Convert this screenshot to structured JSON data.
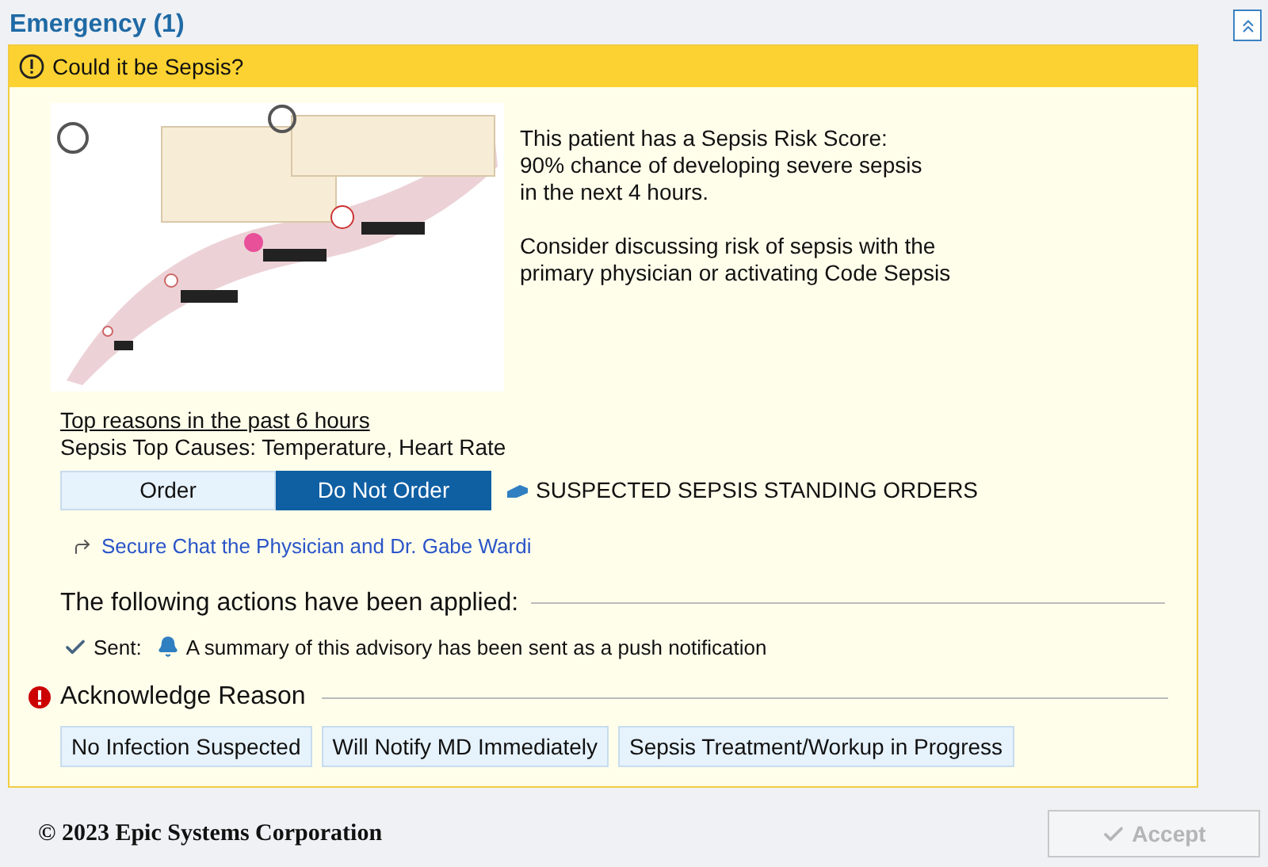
{
  "section": {
    "title": "Emergency (1)"
  },
  "advisory": {
    "title": "Could it be Sepsis?",
    "message": [
      "This patient has a Sepsis Risk Score:",
      "90% chance of developing severe sepsis",
      "in the next 4 hours."
    ],
    "consider": [
      "Consider discussing risk of sepsis with the",
      "primary physician or activating Code Sepsis"
    ],
    "reasons_heading": "Top reasons in the past 6 hours",
    "top_causes": "Sepsis Top Causes: Temperature, Heart Rate",
    "order_options": [
      {
        "label": "Order",
        "selected": false
      },
      {
        "label": "Do Not Order",
        "selected": true
      }
    ],
    "order_set": "SUSPECTED SEPSIS STANDING ORDERS",
    "chat_link": "Secure Chat the Physician and Dr. Gabe Wardi",
    "actions_heading": "The following actions have been applied:",
    "action": {
      "label": "Sent:",
      "text": "A summary of this advisory has been sent as a push notification"
    },
    "acknowledge": {
      "heading": "Acknowledge Reason",
      "required": true,
      "reasons": [
        {
          "label": "No Infection Suspected",
          "selected": false
        },
        {
          "label": "Will Notify MD Immediately",
          "selected": false
        },
        {
          "label": "Sepsis Treatment/Workup in Progress",
          "selected": false
        }
      ]
    }
  },
  "footer": {
    "copyright": "© 2023 Epic Systems Corporation",
    "accept": {
      "label": "Accept",
      "disabled": true
    }
  }
}
